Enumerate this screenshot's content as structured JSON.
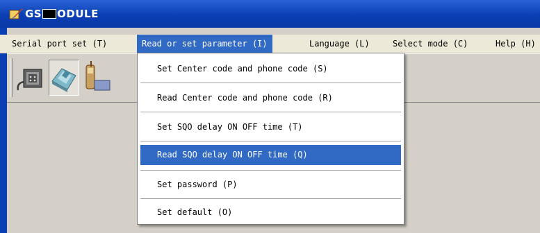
{
  "window": {
    "title_left": "GS",
    "title_right": "ODULE"
  },
  "menubar": {
    "items": [
      {
        "label": "Serial port set (T)"
      },
      {
        "label": "Read or set parameter (I)"
      },
      {
        "label": "Language (L)"
      },
      {
        "label": "Select mode (C)"
      },
      {
        "label": "Help (H)"
      }
    ]
  },
  "toolbar": {
    "buttons": [
      {
        "icon": "serial-port-icon"
      },
      {
        "icon": "modem-icon"
      },
      {
        "icon": "phone-icon"
      }
    ]
  },
  "dropdown": {
    "items": [
      {
        "label": "Set Center code and phone code (S)"
      },
      {
        "label": "Read Center code and phone code (R)"
      },
      {
        "label": "Set SQO delay ON OFF time (T)"
      },
      {
        "label": "Read SQO delay ON OFF time (Q)",
        "highlighted": true
      },
      {
        "label": "Set password (P)"
      },
      {
        "label": "Set default (O)"
      }
    ]
  },
  "colors": {
    "titlebar": "#0a3fb3",
    "highlight": "#316ac5",
    "menubar": "#ece9d8"
  }
}
